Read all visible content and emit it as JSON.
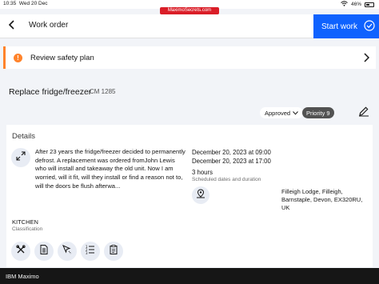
{
  "status_bar": {
    "time": "10:35",
    "date": "Wed 20 Dec",
    "url": "MaximoSecrets.com",
    "battery": "46%"
  },
  "header": {
    "title": "Work order",
    "start_button": "Start work"
  },
  "safety": {
    "label": "Review safety plan"
  },
  "work_order": {
    "title": "Replace fridge/freezer",
    "id": "CM 1285",
    "status": "Approved",
    "priority": "Priority 9"
  },
  "details": {
    "title": "Details",
    "description": "After 23 years the fridge/freezer decided to permanently defrost. A replacement was ordered fromJohn Lewis who will install and takeaway the old unit. Now I am worried, will it fit, will they install or find a reason not to, will the doors be flush afterwa...",
    "start_date": "December 20, 2023  at  09:00",
    "end_date": "December 20, 2023  at  17:00",
    "duration": "3 hours",
    "duration_label": "Scheduled dates and duration",
    "address": "Filleigh Lodge, Filleigh, Barnstaple, Devon, EX320RU, UK",
    "location": "KITCHEN",
    "location_label": "Classification"
  },
  "footer": {
    "brand": "IBM Maximo"
  },
  "colors": {
    "primary": "#0f62fe",
    "warning": "#ff832b",
    "footer_bg": "#161616"
  },
  "icons": [
    "back-arrow-icon",
    "start-work-icon",
    "warning-icon",
    "chevron-right-icon",
    "chevron-down-icon",
    "edit-icon",
    "expand-icon",
    "map-icon",
    "tools-icon",
    "document-icon",
    "cursor-icon",
    "list-icon",
    "clipboard-icon"
  ]
}
